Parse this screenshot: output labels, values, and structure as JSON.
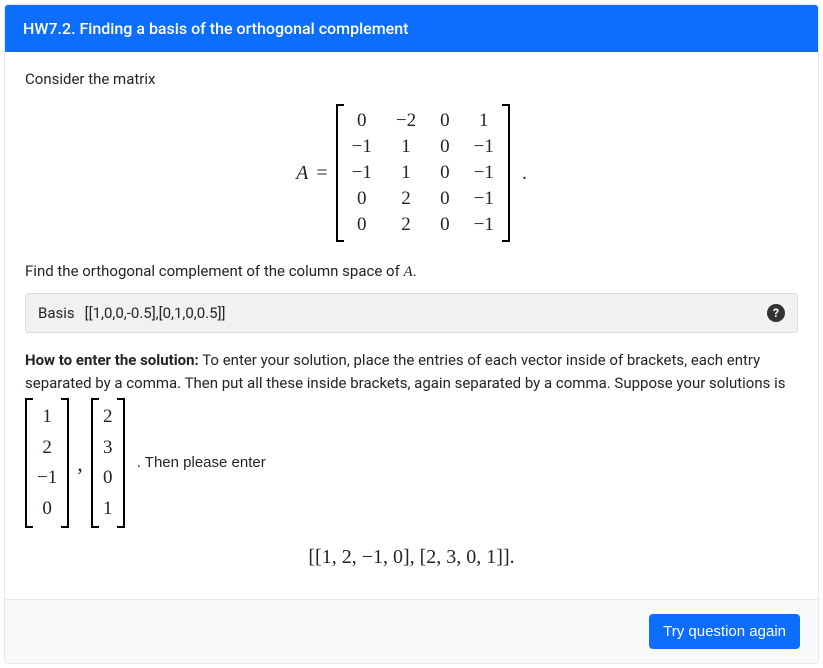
{
  "header": {
    "title": "HW7.2. Finding a basis of the orthogonal complement"
  },
  "problem": {
    "intro": "Consider the matrix",
    "matrix_label": "A",
    "equals": "=",
    "matrix": [
      [
        "0",
        "−2",
        "0",
        "1"
      ],
      [
        "−1",
        "1",
        "0",
        "−1"
      ],
      [
        "−1",
        "1",
        "0",
        "−1"
      ],
      [
        "0",
        "2",
        "0",
        "−1"
      ],
      [
        "0",
        "2",
        "0",
        "−1"
      ]
    ],
    "trailing_period": ".",
    "task_prefix": "Find the orthogonal complement of the column space of ",
    "task_matrix_ref": "A",
    "task_suffix": "."
  },
  "answer": {
    "label": "Basis",
    "value": "[[1,0,0,-0.5],[0,1,0,0.5]]",
    "help_icon": "?"
  },
  "howto": {
    "heading": "How to enter the solution:",
    "text": " To enter your solution, place the entries of each vector inside of brackets, each entry separated by a comma. Then put all these inside brackets, again separated by a comma. Suppose your solutions is",
    "vec1": [
      "1",
      "2",
      "−1",
      "0"
    ],
    "vec2": [
      "2",
      "3",
      "0",
      "1"
    ],
    "then": ". Then please enter",
    "format": "[[1, 2, −1, 0], [2, 3, 0, 1]]."
  },
  "footer": {
    "retry": "Try question again"
  }
}
